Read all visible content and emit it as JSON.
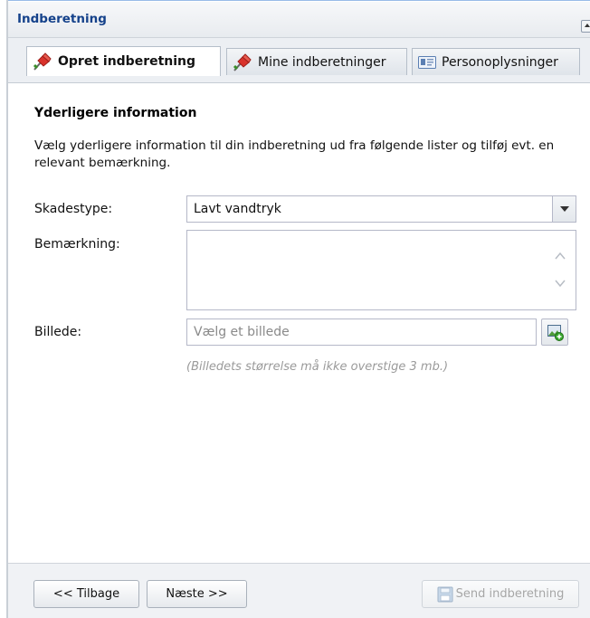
{
  "panel": {
    "title": "Indberetning"
  },
  "tabs": [
    {
      "label": "Opret indberetning",
      "icon": "pushpin-icon",
      "active": true
    },
    {
      "label": "Mine indberetninger",
      "icon": "pushpin-icon",
      "active": false
    },
    {
      "label": "Personoplysninger",
      "icon": "id-card-icon",
      "active": false
    }
  ],
  "form": {
    "section_title": "Yderligere information",
    "description": "Vælg yderligere information til din indberetning ud fra følgende lister og tilføj evt. en relevant bemærkning.",
    "damage_type_label": "Skadestype:",
    "damage_type_value": "Lavt vandtryk",
    "remark_label": "Bemærkning:",
    "remark_value": "",
    "image_label": "Billede:",
    "image_placeholder": "Vælg et billede",
    "image_hint": "(Billedets størrelse må ikke overstige 3 mb.)"
  },
  "footer": {
    "back_label": "<< Tilbage",
    "next_label": "Næste >>",
    "send_label": "Send indberetning",
    "send_icon": "save-disk-icon"
  },
  "colors": {
    "title": "#15428b",
    "hint": "#9a9a9a",
    "disabled_text": "#a6a6a6",
    "pushpin_red": "#d9322b",
    "field_border": "#b5b8c8"
  }
}
